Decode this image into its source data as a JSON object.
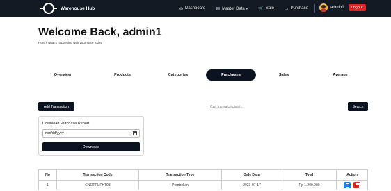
{
  "navbar": {
    "brand": "Warehouse Hub",
    "links": [
      {
        "icon": "dashboard-icon",
        "glyph": "⛀",
        "label": "Dashboard"
      },
      {
        "icon": "master-data-icon",
        "glyph": "▤",
        "label": "Master Data ▾"
      },
      {
        "icon": "cart-icon",
        "glyph": "🛒",
        "label": "Sale"
      },
      {
        "icon": "purchase-icon",
        "glyph": "▭",
        "label": "Purchase"
      }
    ],
    "user": "admin1",
    "logout": "Logout"
  },
  "header": {
    "title": "Welcome Back, admin1",
    "subtitle": "Here's what's happening with your store today"
  },
  "tabs": [
    {
      "label": "Overview",
      "active": false
    },
    {
      "label": "Products",
      "active": false
    },
    {
      "label": "Categories",
      "active": false
    },
    {
      "label": "Purchases",
      "active": true
    },
    {
      "label": "Sales",
      "active": false
    },
    {
      "label": "Average",
      "active": false
    }
  ],
  "controls": {
    "add_label": "Add Transaction",
    "search_placeholder": "Cari transaksi disini...",
    "search_label": "Search"
  },
  "download_card": {
    "title": "Download Purchase Report",
    "date_value": "mm/dd/yyyy",
    "button": "Download"
  },
  "table": {
    "headers": [
      "No",
      "Transaction Code",
      "Transaction Type",
      "Sale Date",
      "Total",
      "Action"
    ],
    "rows": [
      [
        "1",
        "CNOTPUFHT98",
        "Pembelian",
        "2023-07-17",
        "Rp 1.200.000"
      ]
    ]
  }
}
